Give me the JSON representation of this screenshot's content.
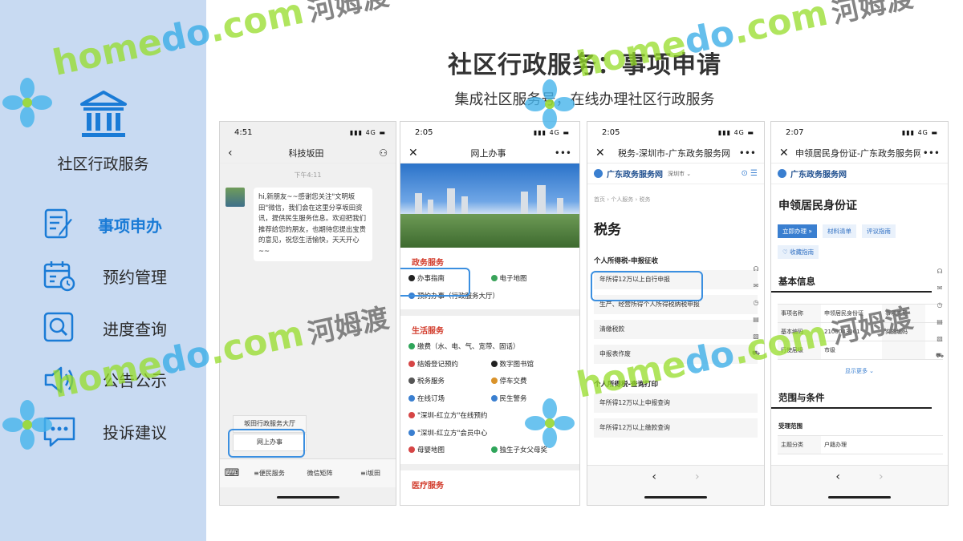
{
  "sidebar": {
    "brand_title": "社区行政服务",
    "items": [
      {
        "label": "事项申办",
        "active": true
      },
      {
        "label": "预约管理"
      },
      {
        "label": "进度查询"
      },
      {
        "label": "公告公示"
      },
      {
        "label": "投诉建议"
      }
    ]
  },
  "header": {
    "title": "社区行政服务：事项申请",
    "subtitle": "集成社区服务号，在线办理社区行政服务"
  },
  "watermark": {
    "brand": "homedo.com",
    "brand_blue": "do",
    "brand_cn": "河姆渡"
  },
  "phone1": {
    "time": "4:51",
    "network": "4G",
    "title": "科技坂田",
    "chat_time": "下午4:11",
    "message": "hi,新朋友~~感谢您关注\"文明坂田\"微信，我们会在这里分享坂田资讯，提供民生服务信息。欢迎把我们推荐给您的朋友，也期待您提出宝贵的意见，祝您生活愉快，天天开心~~",
    "menu_popup_top": "坂田行政服务大厅",
    "menu_popup_highlight": "网上办事",
    "bottom_menu": [
      "≡便民服务",
      "微信矩阵",
      "≡i坂田"
    ]
  },
  "phone2": {
    "time": "2:05",
    "network": "4G",
    "title": "网上办事",
    "sections": [
      {
        "title": "政务服务",
        "items": [
          {
            "label": "办事指南",
            "icon_color": "#222222"
          },
          {
            "label": "电子地图",
            "icon_color": "#3aa35a"
          },
          {
            "label": "预约办事（行政服务大厅）",
            "icon_color": "#3a7fd0",
            "full": true
          }
        ]
      },
      {
        "title": "生活服务",
        "items": [
          {
            "label": "缴费（水、电、气、宽带、固话）",
            "icon_color": "#2fa55a",
            "full": true
          },
          {
            "label": "结婚登记预约",
            "icon_color": "#d64545"
          },
          {
            "label": "数字图书馆",
            "icon_color": "#222222"
          },
          {
            "label": "税务服务",
            "icon_color": "#555555"
          },
          {
            "label": "停车交费",
            "icon_color": "#d9922a"
          },
          {
            "label": "在线订场",
            "icon_color": "#3a7fd0"
          },
          {
            "label": "民生警务",
            "icon_color": "#3a7fd0"
          },
          {
            "label": "\"深圳-红立方\"在线预约",
            "icon_color": "#d64545",
            "full": true
          },
          {
            "label": "\"深圳-红立方\"会员中心",
            "icon_color": "#3a7fd0",
            "full": true
          },
          {
            "label": "母婴地图",
            "icon_color": "#d64545"
          },
          {
            "label": "独生子女父母奖",
            "icon_color": "#2fa55a"
          }
        ]
      },
      {
        "title": "医疗服务",
        "items": []
      }
    ]
  },
  "phone3": {
    "time": "2:05",
    "network": "4G",
    "title": "税务-深圳市-广东政务服务网",
    "portal": "广东政务服务网",
    "city": "深圳市",
    "breadcrumb": "首页  ›  个人服务  ›  税务",
    "page_title": "税务",
    "group1": "个人所得税-申报征收",
    "group1_items": [
      "年所得12万以上自行申报",
      "生产、经营所得个人所得税纳税申报",
      "清缴税款",
      "申报表作废"
    ],
    "group2": "个人所得税-查询打印",
    "group2_items": [
      "年所得12万以上申报查询",
      "年所得12万以上缴款查询"
    ]
  },
  "phone4": {
    "time": "2:07",
    "network": "4G",
    "title": "申领居民身份证-广东政务服务网",
    "portal": "广东政务服务网",
    "page_title": "申领居民身份证",
    "buttons": [
      "立即办理 »",
      "材料清单",
      "评议指南"
    ],
    "fav": "收藏指南",
    "basic_info": "基本信息",
    "table": [
      [
        "事项名称",
        "申领居民身份证",
        "事项类型"
      ],
      [
        "基本编码",
        "2106043001",
        "实施编码"
      ],
      [
        "行使层级",
        "市级",
        ""
      ]
    ],
    "show_more": "显示更多",
    "scope_title": "范围与条件",
    "scope_label": "受理范围",
    "scope_row": [
      "主题分类",
      "户籍办理"
    ]
  }
}
